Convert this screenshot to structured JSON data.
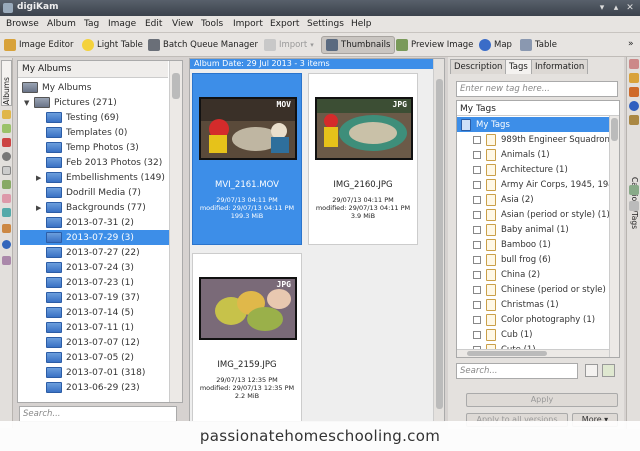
{
  "window": {
    "app_title": "digiKam"
  },
  "menu": [
    "Browse",
    "Album",
    "Tag",
    "Image",
    "Edit",
    "View",
    "Tools",
    "Import",
    "Export",
    "Settings",
    "Help"
  ],
  "toolbar": {
    "image_editor": "Image Editor",
    "light_table": "Light Table",
    "batch_queue": "Batch Queue Manager",
    "import": "Import",
    "thumbnails": "Thumbnails",
    "preview_image": "Preview Image",
    "map": "Map",
    "table": "Table"
  },
  "left_sidebar": {
    "albums_tab": "Albums"
  },
  "albums": {
    "header": "My Albums",
    "root": "My Albums",
    "pictures": "Pictures (271)",
    "items": [
      "Testing (69)",
      "Templates (0)",
      "Temp Photos (3)",
      "Feb 2013 Photos (32)",
      "Embellishments (149)",
      "Dodrill Media (7)",
      "Backgrounds (77)",
      "2013-07-31 (2)",
      "2013-07-29 (3)",
      "2013-07-27 (22)",
      "2013-07-24 (3)",
      "2013-07-23 (1)",
      "2013-07-19 (37)",
      "2013-07-14 (5)",
      "2013-07-11 (1)",
      "2013-07-07 (12)",
      "2013-07-05 (2)",
      "2013-07-01 (318)",
      "2013-06-29 (23)"
    ],
    "search_placeholder": "Search..."
  },
  "center": {
    "album_header": "Album Date: 29 Jul 2013 - 3 items",
    "cards": [
      {
        "badge": "MOV",
        "name": "MVI_2161.MOV",
        "date": "29/07/13 04:11 PM",
        "modified": "modified: 29/07/13 04:11 PM",
        "size": "199.3 MiB"
      },
      {
        "badge": "JPG",
        "name": "IMG_2160.JPG",
        "date": "29/07/13 04:11 PM",
        "modified": "modified: 29/07/13 04:11 PM",
        "size": "3.9 MiB"
      },
      {
        "badge": "JPG",
        "name": "IMG_2159.JPG",
        "date": "29/07/13 12:35 PM",
        "modified": "modified: 29/07/13 12:35 PM",
        "size": "2.2 MiB"
      }
    ]
  },
  "right_panel": {
    "tabs": [
      "Description",
      "Tags",
      "Information"
    ],
    "tag_search_placeholder": "Enter new tag here...",
    "tag_header": "My Tags",
    "tag_root": "My Tags",
    "tags": [
      "989th Engineer Squadron",
      "Animals (1)",
      "Architecture (1)",
      "Army Air Corps, 1945, 194",
      "Asia (2)",
      "Asian (period or style) (1)",
      "Baby animal (1)",
      "Bamboo (1)",
      "bull frog (6)",
      "China (2)",
      "Chinese (period or style) (1)",
      "Christmas (1)",
      "Color photography (1)",
      "Cub (1)",
      "Cute (1)"
    ],
    "search_placeholder": "Search...",
    "apply": "Apply",
    "apply_all": "Apply to all versions",
    "more": "More"
  },
  "right_sidebar": {
    "captions_tab": "Captions/Tags"
  },
  "watermark": "passionatehomeschooling.com"
}
